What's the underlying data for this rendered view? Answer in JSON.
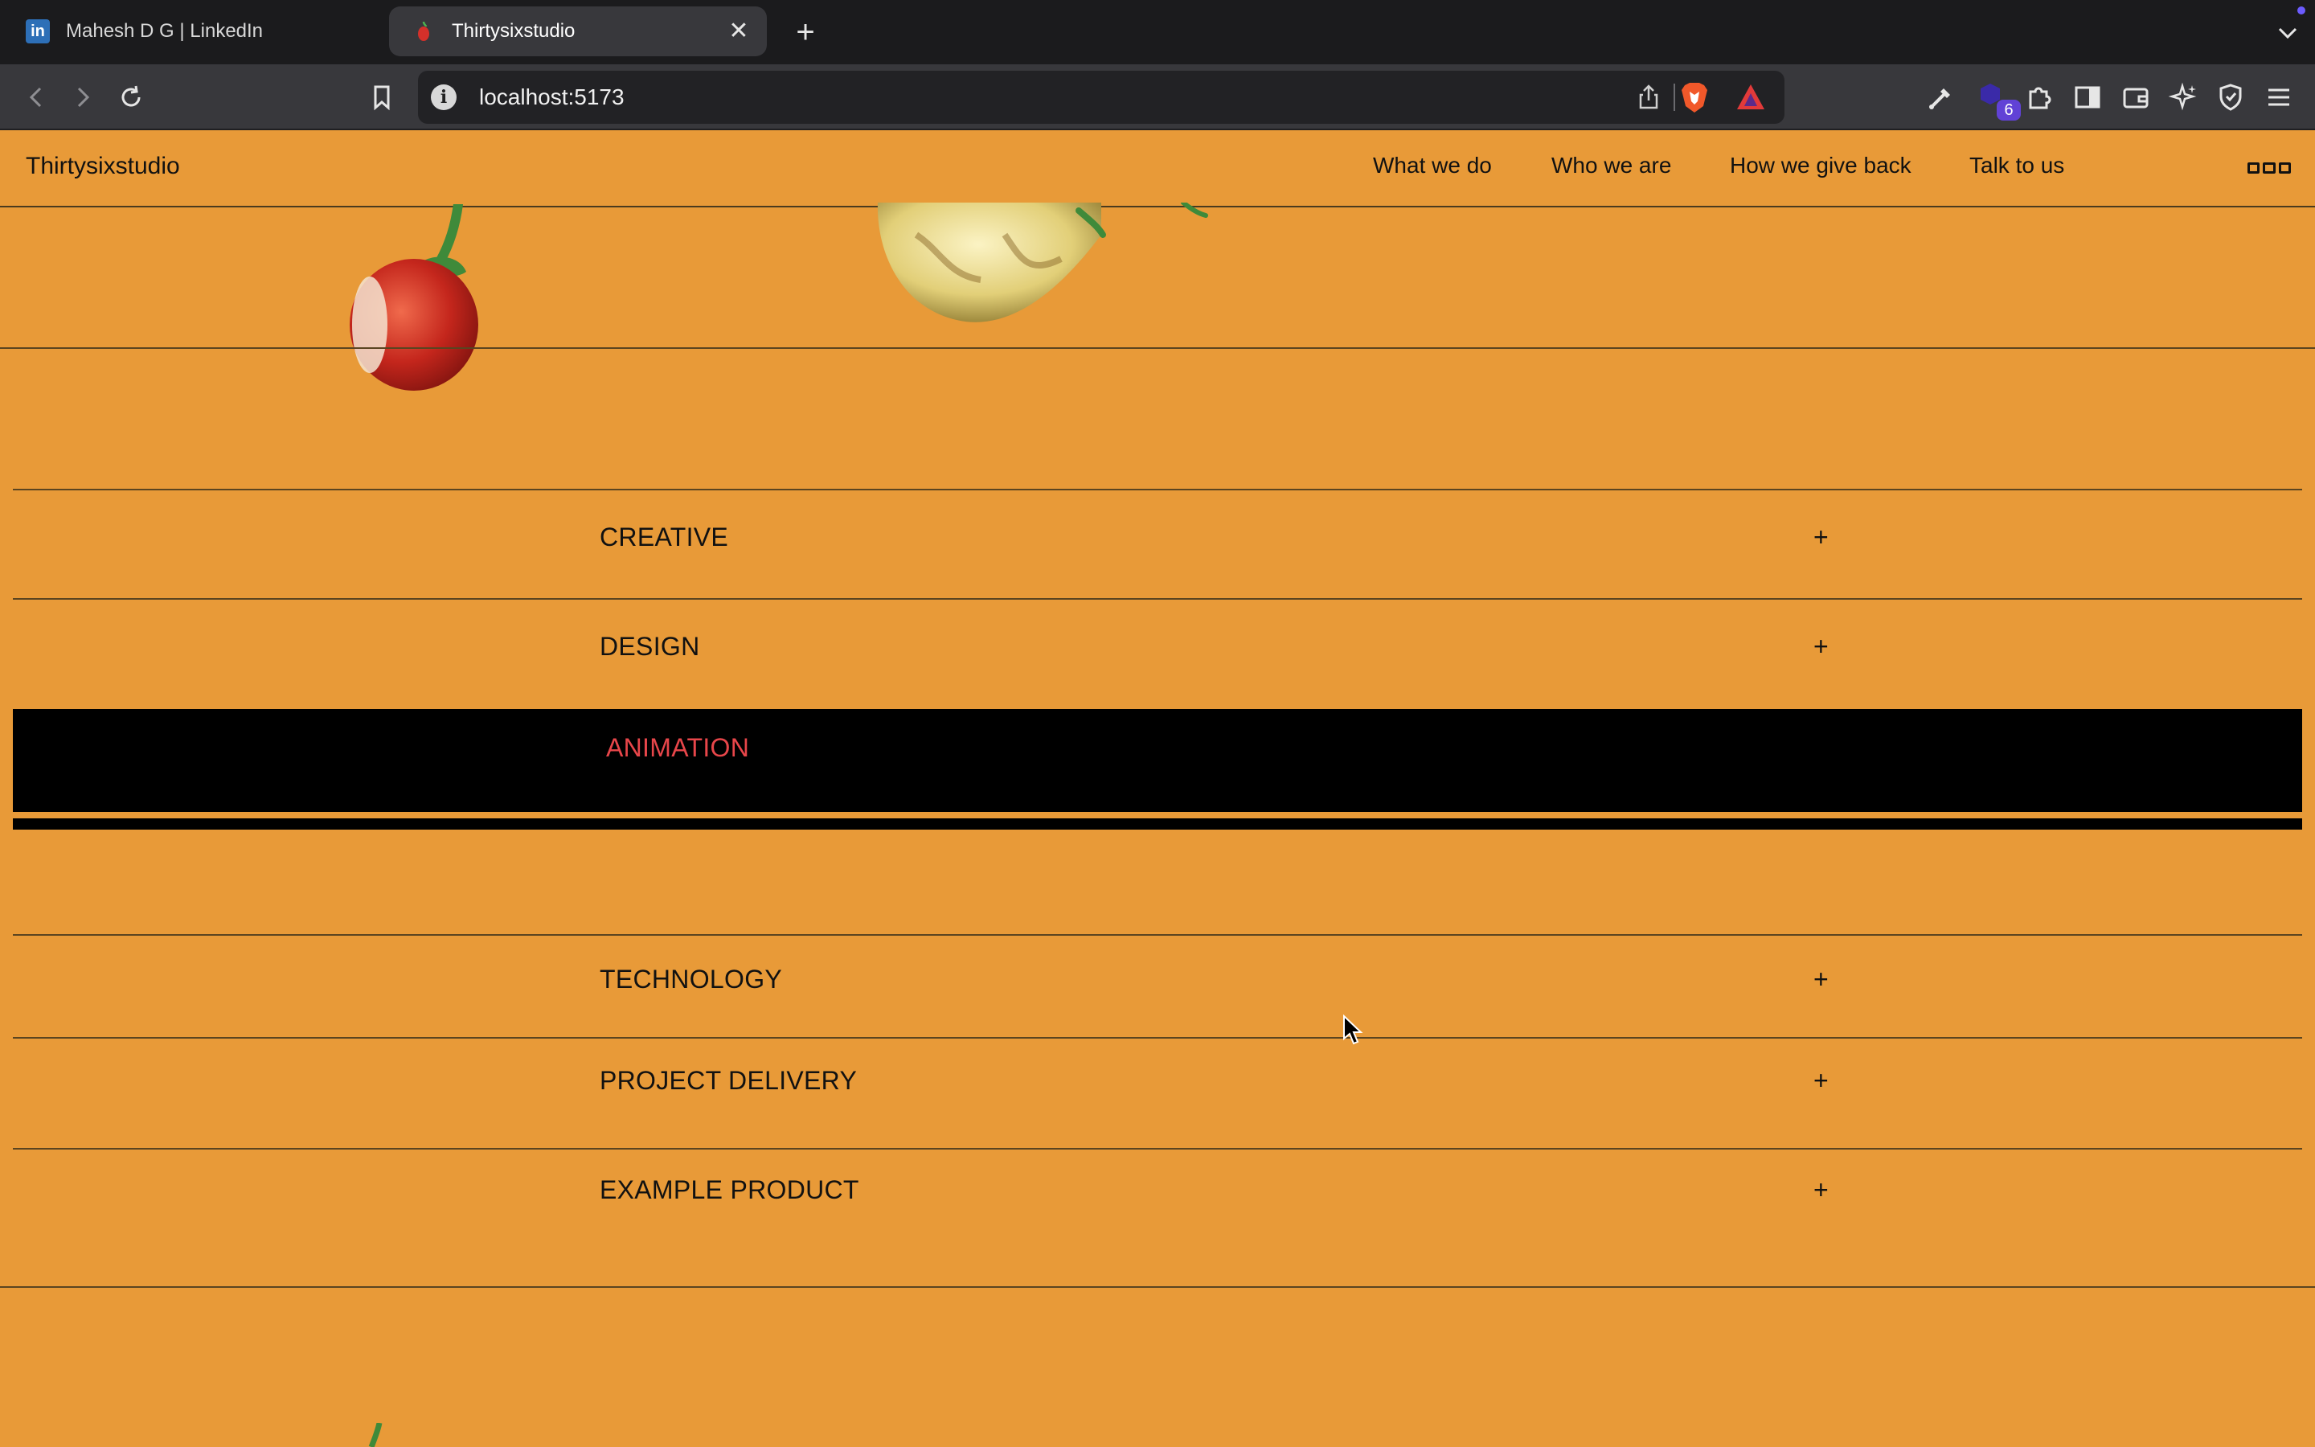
{
  "browser": {
    "tabs": [
      {
        "title": "Mahesh D G | LinkedIn",
        "favicon": "linkedin-icon",
        "active": false
      },
      {
        "title": "Thirtysixstudio",
        "favicon": "chili-icon",
        "active": true
      }
    ],
    "url": "localhost:5173",
    "extension_badge": "6"
  },
  "site": {
    "logo": "Thirtysixstudio",
    "nav": [
      "What we do",
      "Who we are",
      "How we give back",
      "Talk to us"
    ]
  },
  "accordion": {
    "items": [
      {
        "label": "CREATIVE",
        "expanded": false
      },
      {
        "label": "DESIGN",
        "expanded": false
      },
      {
        "label": "ANIMATION",
        "expanded": true
      },
      {
        "label": "TECHNOLOGY",
        "expanded": false
      },
      {
        "label": "PROJECT DELIVERY",
        "expanded": false
      },
      {
        "label": "EXAMPLE PRODUCT",
        "expanded": false
      }
    ],
    "plus_symbol": "+"
  },
  "colors": {
    "page_background": "#e89a38",
    "active_row_background": "#000000",
    "active_label": "#e8464a"
  }
}
